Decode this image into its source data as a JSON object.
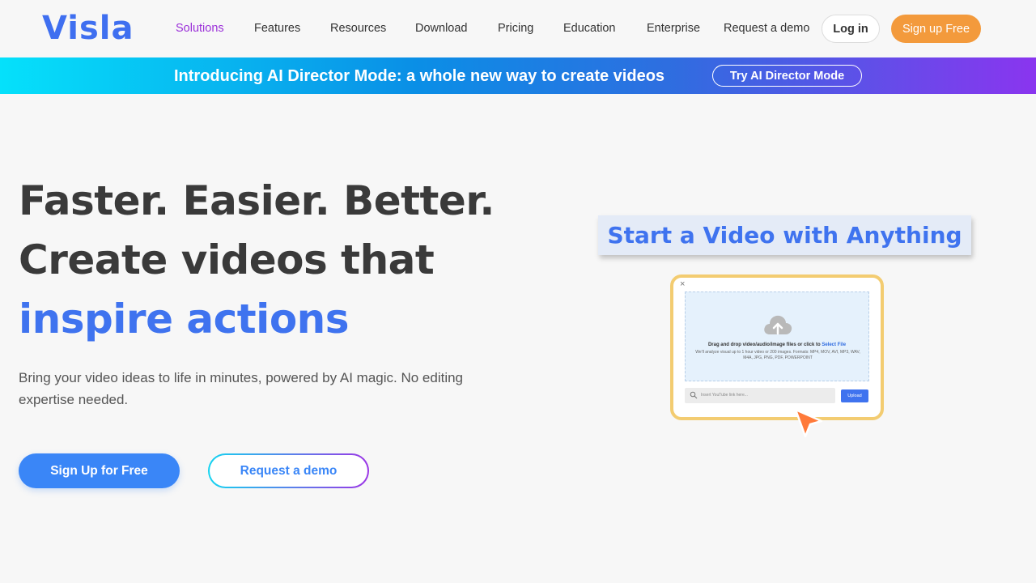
{
  "nav": {
    "logo": "Visla",
    "links": [
      "Solutions",
      "Features",
      "Resources",
      "Download",
      "Pricing",
      "Education",
      "Enterprise",
      "Request a demo"
    ],
    "login": "Log in",
    "signup": "Sign up Free"
  },
  "banner": {
    "text": "Introducing AI Director Mode: a whole new way to create videos",
    "button": "Try AI Director Mode"
  },
  "hero": {
    "line1": "Faster. Easier. Better.",
    "line2": "Create videos that",
    "line3": "inspire actions",
    "subtitle": "Bring your video ideas to life in minutes, powered by AI magic. No editing expertise needed.",
    "cta_primary": "Sign Up for Free",
    "cta_secondary": "Request a demo"
  },
  "illustration": {
    "card_title": "Start a Video with Anything",
    "close": "×",
    "drop_title": "Drag and drop video/audio/image files or click to ",
    "drop_link": "Select File",
    "drop_desc": "We'll analyze visual up to 1 hour video or 200 images. Formats: MP4, MOV, AVI, MP3, WAV, M4A, JPG, PNG, PDF, POWERPOINT",
    "input_placeholder": "Insert YouTube link here...",
    "upload": "Upload"
  },
  "colors": {
    "brand_blue": "#3f73ef",
    "accent_orange": "#f39a3c",
    "active_purple": "#9b30d9"
  }
}
